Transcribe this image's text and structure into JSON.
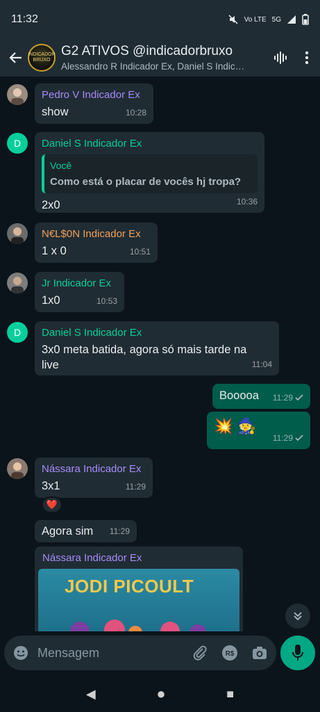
{
  "status_bar": {
    "time": "11:32",
    "network": "Vo LTE",
    "signal": "5G"
  },
  "header": {
    "back_icon": "arrow-left-icon",
    "group_avatar_text": "INDICADOR BRUXO",
    "title": "G2 ATIVOS @indicadorbruxo",
    "subtitle": "Alessandro R Indicador Ex, Daniel S Indic…",
    "audio_icon": "voice-call-waveform-icon",
    "menu_icon": "more-vert-icon"
  },
  "colors": {
    "incoming_bubble": "#202c33",
    "outgoing_bubble": "#005c4b",
    "accent": "#00a884",
    "sender_pedro": "#a78bfa",
    "sender_daniel": "#06cf9c",
    "sender_nelson": "#f0a05a",
    "sender_jr": "#06cf9c",
    "sender_nassara": "#a78bfa"
  },
  "messages": [
    {
      "sender": "Pedro V Indicador Ex",
      "text": "show",
      "time": "10:28"
    },
    {
      "sender": "Daniel S Indicador Ex",
      "avatar_letter": "D",
      "quote_name": "Você",
      "quote_text": "Como está o placar de vocês hj tropa?",
      "text": "2x0",
      "time": "10:36"
    },
    {
      "sender": "N€L$0N Indicador Ex",
      "text": "1 x 0",
      "time": "10:51"
    },
    {
      "sender": "Jr Indicador Ex",
      "text": "1x0",
      "time": "10:53"
    },
    {
      "sender": "Daniel S Indicador Ex",
      "avatar_letter": "D",
      "text": "3x0 meta batida, agora só mais tarde na live",
      "time": "11:04"
    },
    {
      "outgoing": true,
      "text": "Booooa",
      "time": "11:29"
    },
    {
      "outgoing": true,
      "text": "💥 🧙",
      "time": "11:29"
    },
    {
      "sender": "Nássara Indicador Ex",
      "text": "3x1",
      "time": "11:29",
      "reaction": "❤️"
    },
    {
      "text": "Agora sim",
      "time": "11:29"
    },
    {
      "sender": "Nássara Indicador Ex",
      "image_text": "JODI PICOULT"
    }
  ],
  "composer": {
    "placeholder": "Mensagem"
  },
  "nav": {
    "back": "◀",
    "home": "●",
    "recents": "■"
  }
}
